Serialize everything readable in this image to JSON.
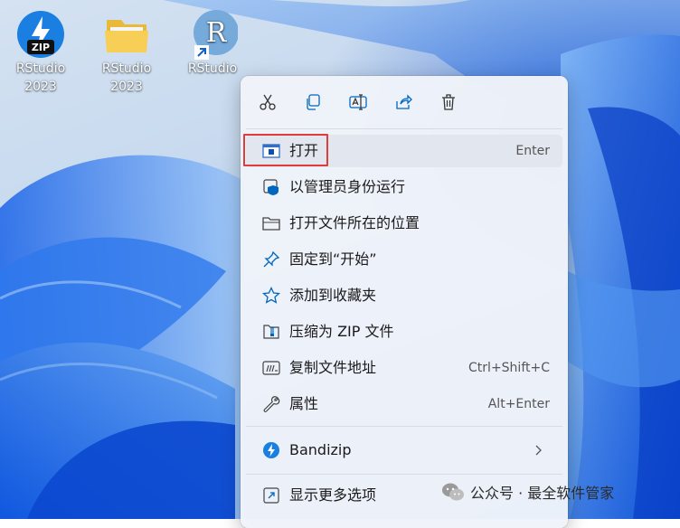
{
  "desktop": {
    "icons": [
      {
        "name": "RStudio",
        "sub": "2023",
        "kind": "zip"
      },
      {
        "name": "RStudio",
        "sub": "2023",
        "kind": "folder"
      },
      {
        "name": "RStudio",
        "sub": "",
        "kind": "shortcut",
        "glyph": "R"
      }
    ],
    "zip_badge": "ZIP"
  },
  "context_menu": {
    "toolbar": [
      {
        "name": "cut",
        "icon": "scissors-icon"
      },
      {
        "name": "copy",
        "icon": "copy-icon"
      },
      {
        "name": "rename",
        "icon": "rename-icon"
      },
      {
        "name": "share",
        "icon": "share-icon"
      },
      {
        "name": "delete",
        "icon": "trash-icon"
      }
    ],
    "items": [
      {
        "label": "打开",
        "shortcut": "Enter",
        "icon": "open-window-icon",
        "highlighted": true
      },
      {
        "label": "以管理员身份运行",
        "shortcut": "",
        "icon": "shield-icon"
      },
      {
        "label": "打开文件所在的位置",
        "shortcut": "",
        "icon": "folder-icon"
      },
      {
        "label": "固定到“开始”",
        "shortcut": "",
        "icon": "pin-icon"
      },
      {
        "label": "添加到收藏夹",
        "shortcut": "",
        "icon": "star-icon"
      },
      {
        "label": "压缩为 ZIP 文件",
        "shortcut": "",
        "icon": "zip-icon"
      },
      {
        "label": "复制文件地址",
        "shortcut": "Ctrl+Shift+C",
        "icon": "copy-path-icon"
      },
      {
        "label": "属性",
        "shortcut": "Alt+Enter",
        "icon": "wrench-icon"
      },
      {
        "label": "Bandizip",
        "shortcut": "",
        "icon": "bandizip-icon",
        "submenu": true
      },
      {
        "label": "显示更多选项",
        "shortcut": "",
        "icon": "more-options-icon"
      }
    ]
  },
  "watermark": {
    "text": "公众号 · 最全软件管家"
  },
  "colors": {
    "accent": "#0067c0",
    "highlight_border": "#e23b3b",
    "menu_bg": "#f0f3f9"
  }
}
